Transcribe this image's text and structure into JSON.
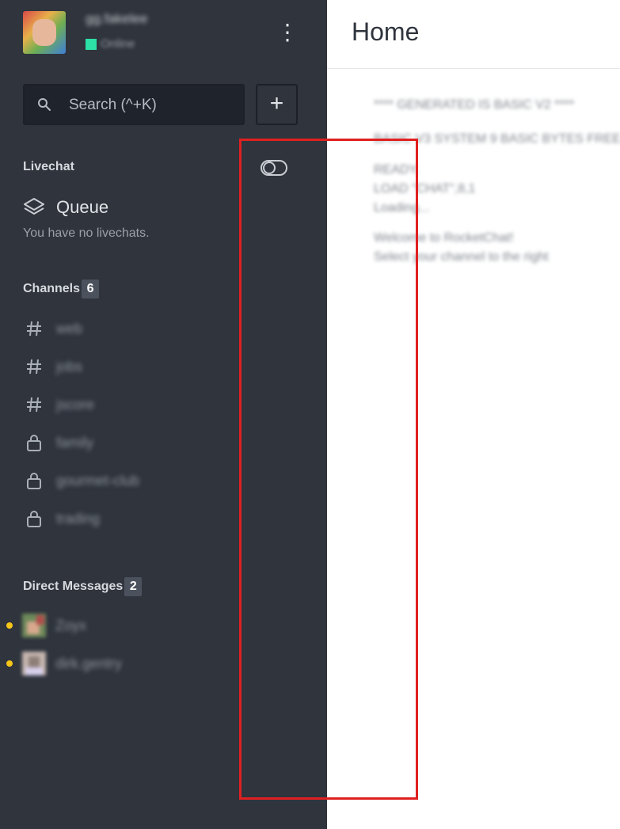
{
  "user": {
    "username": "gg.fakelee",
    "status": "Online",
    "status_color": "#2de0a5"
  },
  "search": {
    "placeholder": "Search (^+K)"
  },
  "buttons": {
    "create": "+",
    "menu": "⋮"
  },
  "livechat": {
    "title": "Livechat",
    "queue_label": "Queue",
    "empty_message": "You have no livechats."
  },
  "channels": {
    "title": "Channels",
    "count": "6",
    "items": [
      {
        "name": "web",
        "type": "public"
      },
      {
        "name": "jobs",
        "type": "public"
      },
      {
        "name": "jscore",
        "type": "public"
      },
      {
        "name": "family",
        "type": "private"
      },
      {
        "name": "gourmet-club",
        "type": "private"
      },
      {
        "name": "trading",
        "type": "private"
      }
    ]
  },
  "direct_messages": {
    "title": "Direct Messages",
    "count": "2",
    "items": [
      {
        "name": "Zoyx",
        "unread": true
      },
      {
        "name": "dirk.gentry",
        "unread": true
      }
    ]
  },
  "main": {
    "title": "Home",
    "lines": [
      "**** GENERATED IS BASIC V2 ****",
      "BASIC V3 SYSTEM 9 BASIC BYTES FREE",
      "READY.",
      "LOAD \"CHAT\",8,1",
      "Loading...",
      "Welcome to RocketChat!",
      "Select your channel to the right"
    ]
  },
  "colors": {
    "sidebar_bg": "#2f343d",
    "highlight": "#e02020",
    "unread_dot": "#f5c518"
  }
}
